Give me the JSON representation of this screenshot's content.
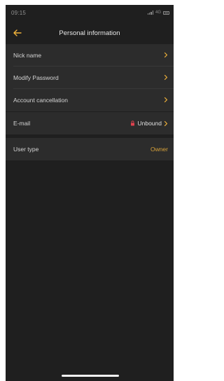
{
  "status_bar": {
    "time": "09:15",
    "network": "4G"
  },
  "header": {
    "title": "Personal information",
    "back_icon": "arrow-left-icon"
  },
  "account_section": {
    "items": [
      {
        "label": "Nick name",
        "icon": "chevron-right-icon"
      },
      {
        "label": "Modify Password",
        "icon": "chevron-right-icon"
      },
      {
        "label": "Account cancellation",
        "icon": "chevron-right-icon"
      }
    ]
  },
  "email_row": {
    "label": "E-mail",
    "value": "Unbound",
    "icon": "lock-icon"
  },
  "user_type_row": {
    "label": "User type",
    "value": "Owner"
  },
  "colors": {
    "accent": "#f0b23a",
    "background": "#1f1f1f",
    "row_background": "#2c2c2c",
    "owner_text": "#d7a23a",
    "lock": "#e0424f"
  }
}
